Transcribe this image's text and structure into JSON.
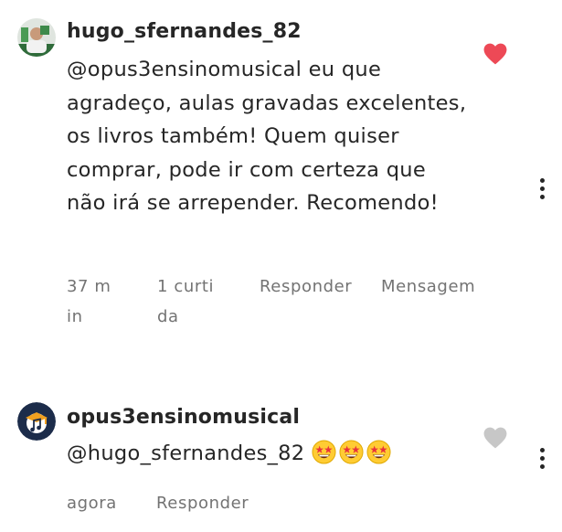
{
  "comments": [
    {
      "username": "hugo_sfernandes_82",
      "text": "@opus3ensinomusical eu que agradeço, aulas gravadas excelentes, os livros também! Quem quiser comprar, pode ir com certeza que não irá se arrepender. Recomendo!",
      "time": "37 min",
      "likes": "1 curtida",
      "reply_label": "Responder",
      "message_label": "Mensagem",
      "liked": true
    },
    {
      "username": "opus3ensinomusical",
      "text": "@hugo_sfernandes_82",
      "emojis": [
        "star-struck-emoji",
        "star-struck-emoji",
        "star-struck-emoji"
      ],
      "time": "agora",
      "reply_label": "Responder",
      "liked": false
    }
  ],
  "colors": {
    "liked_heart": "#ed4956",
    "unliked_heart": "#c7c7c7",
    "text": "#262626",
    "meta": "#737373"
  }
}
